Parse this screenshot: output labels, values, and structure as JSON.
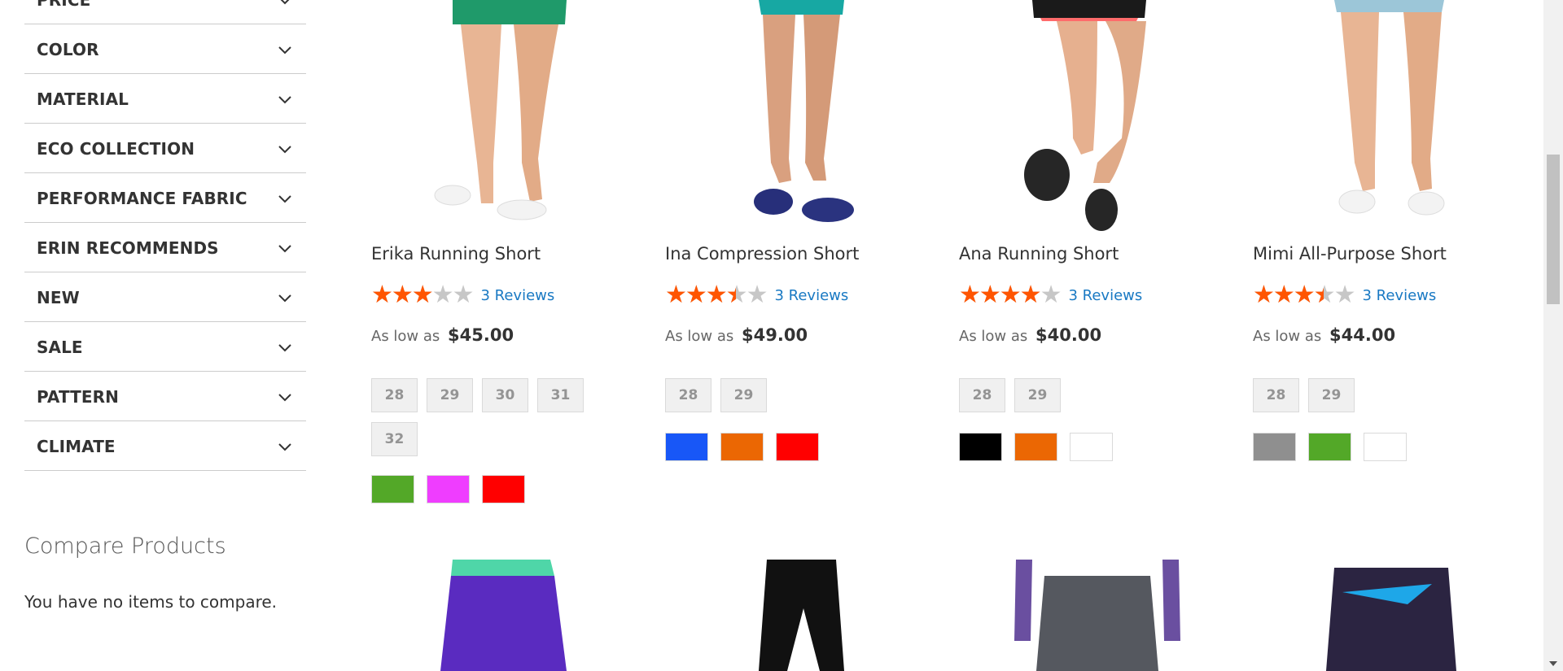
{
  "filters": [
    {
      "label": "PRICE"
    },
    {
      "label": "COLOR"
    },
    {
      "label": "MATERIAL"
    },
    {
      "label": "ECO COLLECTION"
    },
    {
      "label": "PERFORMANCE FABRIC"
    },
    {
      "label": "ERIN RECOMMENDS"
    },
    {
      "label": "NEW"
    },
    {
      "label": "SALE"
    },
    {
      "label": "PATTERN"
    },
    {
      "label": "CLIMATE"
    }
  ],
  "compare": {
    "title": "Compare Products",
    "empty": "You have no items to compare."
  },
  "products": [
    {
      "name": "Erika Running Short",
      "rating": 0.6,
      "reviews": "3 Reviews",
      "price_prefix": "As low as",
      "price": "$45.00",
      "sizes": [
        "28",
        "29",
        "30",
        "31",
        "32"
      ],
      "colors": [
        "#53a828",
        "#ef3dff",
        "#ff0000"
      ]
    },
    {
      "name": "Ina Compression Short",
      "rating": 0.7,
      "reviews": "3 Reviews",
      "price_prefix": "As low as",
      "price": "$49.00",
      "sizes": [
        "28",
        "29"
      ],
      "colors": [
        "#1857f7",
        "#eb6703",
        "#ff0000"
      ]
    },
    {
      "name": "Ana Running Short",
      "rating": 0.8,
      "reviews": "3 Reviews",
      "price_prefix": "As low as",
      "price": "$40.00",
      "sizes": [
        "28",
        "29"
      ],
      "colors": [
        "#000000",
        "#eb6703",
        "#ffffff"
      ]
    },
    {
      "name": "Mimi All-Purpose Short",
      "rating": 0.7,
      "reviews": "3 Reviews",
      "price_prefix": "As low as",
      "price": "$44.00",
      "sizes": [
        "28",
        "29"
      ],
      "colors": [
        "#8f8f8f",
        "#53a828",
        "#ffffff"
      ]
    }
  ],
  "colors": {
    "star_filled": "#ff5501",
    "star_empty": "#c7c7c7",
    "link": "#1979c3"
  }
}
